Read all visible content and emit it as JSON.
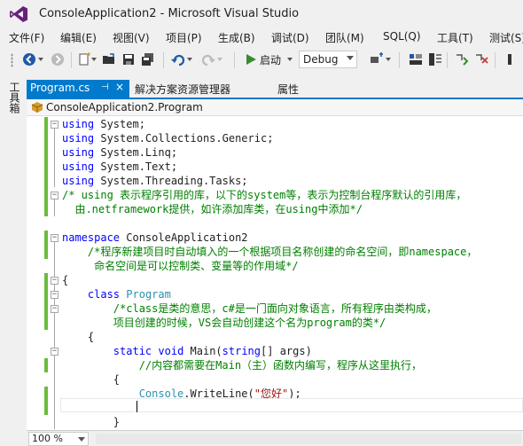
{
  "window": {
    "title": "ConsoleApplication2 - Microsoft Visual Studio"
  },
  "menu": [
    "文件(F)",
    "编辑(E)",
    "视图(V)",
    "项目(P)",
    "生成(B)",
    "调试(D)",
    "团队(M)",
    "SQL(Q)",
    "工具(T)",
    "测试(S)"
  ],
  "toolbar": {
    "start_label": "启动",
    "config": "Debug"
  },
  "sidebar": {
    "toolbox": "工具箱"
  },
  "tabs": {
    "active": "Program.cs",
    "solution_explorer": "解决方案资源管理器",
    "properties": "属性"
  },
  "nav": {
    "member": "ConsoleApplication2.Program"
  },
  "code": {
    "l1": [
      "using",
      " System;"
    ],
    "l2": [
      "using",
      " System.Collections.Generic;"
    ],
    "l3": [
      "using",
      " System.Linq;"
    ],
    "l4": [
      "using",
      " System.Text;"
    ],
    "l5": [
      "using",
      " System.Threading.Tasks;"
    ],
    "l6": "/* using 表示程序引用的库，以下的system等，表示为控制台程序默认的引用库，",
    "l7": "  由.netframework提供，如许添加库类，在using中添加*/",
    "l9": [
      "namespace",
      " ConsoleApplication2"
    ],
    "l10": "    /*程序新建项目时自动填入的一个根据项目名称创建的命名空间，即namespace，",
    "l11": "     命名空间是可以控制类、变量等的作用域*/",
    "l12": "{",
    "l13": [
      "    ",
      "class",
      " ",
      "Program"
    ],
    "l14": "        /*class是类的意思，c#是一门面向对象语言，所有程序由类构成，",
    "l15": "        项目创建的时候，VS会自动创建这个名为program的类*/",
    "l16": "    {",
    "l17": [
      "        ",
      "static",
      " ",
      "void",
      " Main(",
      "string",
      "[] args)"
    ],
    "l18": "            //内容都需要在Main（主）函数内编写，程序从这里执行，",
    "l19": "        {",
    "l20": [
      "            ",
      "Console",
      ".WriteLine(",
      "\"您好\"",
      ");"
    ],
    "l22": "        }"
  },
  "status": {
    "zoom": "100 %"
  },
  "colors": {
    "accent": "#007acc",
    "keyword": "#0000ff",
    "type": "#2b91af",
    "comment": "#008000",
    "string": "#a31515",
    "changebar": "#6bbd3c"
  }
}
